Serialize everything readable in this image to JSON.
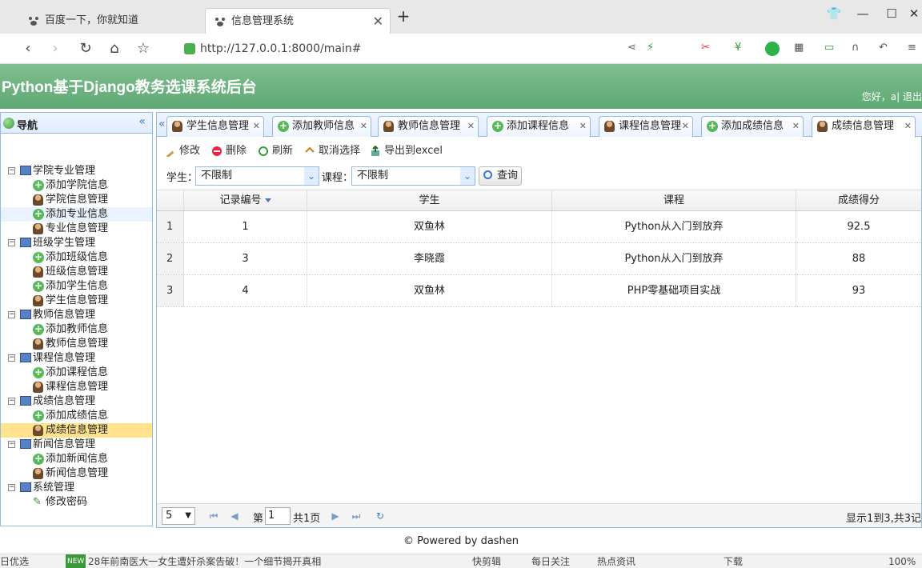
{
  "browser": {
    "tabs": [
      {
        "title": "百度一下，你就知道",
        "active": false
      },
      {
        "title": "信息管理系统",
        "active": true
      }
    ],
    "new_tab": "+",
    "url": "http://127.0.0.1:8000/main#"
  },
  "app": {
    "title": "Python基于Django教务选课系统后台",
    "welcome": "您好，a| 退出"
  },
  "nav": {
    "title": "导航",
    "collapse_icon": "«",
    "groups": [
      {
        "label": "学院专业管理",
        "items": [
          "添加学院信息",
          "学院信息管理",
          "添加专业信息",
          "专业信息管理"
        ]
      },
      {
        "label": "班级学生管理",
        "items": [
          "添加班级信息",
          "班级信息管理",
          "添加学生信息",
          "学生信息管理"
        ]
      },
      {
        "label": "教师信息管理",
        "items": [
          "添加教师信息",
          "教师信息管理"
        ]
      },
      {
        "label": "课程信息管理",
        "items": [
          "添加课程信息",
          "课程信息管理"
        ]
      },
      {
        "label": "成绩信息管理",
        "items": [
          "添加成绩信息",
          "成绩信息管理"
        ]
      },
      {
        "label": "新闻信息管理",
        "items": [
          "添加新闻信息",
          "新闻信息管理"
        ]
      },
      {
        "label": "系统管理",
        "items": [
          "修改密码"
        ]
      }
    ],
    "selected_item": "成绩信息管理"
  },
  "content_tabs": [
    {
      "label": "学生信息管理",
      "icon": "user-icon"
    },
    {
      "label": "添加教师信息",
      "icon": "add-icon"
    },
    {
      "label": "教师信息管理",
      "icon": "user-icon"
    },
    {
      "label": "添加课程信息",
      "icon": "add-icon"
    },
    {
      "label": "课程信息管理",
      "icon": "user-icon"
    },
    {
      "label": "添加成绩信息",
      "icon": "add-icon"
    },
    {
      "label": "成绩信息管理",
      "icon": "user-icon",
      "active": true
    }
  ],
  "grid_toolbar": {
    "edit": "修改",
    "delete": "删除",
    "refresh": "刷新",
    "unselect": "取消选择",
    "export": "导出到excel"
  },
  "filter": {
    "student_label": "学生：",
    "student_value": "不限制",
    "course_label": "课程：",
    "course_value": "不限制",
    "query": "查询"
  },
  "table": {
    "columns": [
      "记录编号",
      "学生",
      "课程",
      "成绩得分"
    ],
    "rows": [
      {
        "rownum": "1",
        "id": "1",
        "student": "双鱼林",
        "course": "Python从入门到放弃",
        "score": "92.5"
      },
      {
        "rownum": "2",
        "id": "3",
        "student": "李晓霞",
        "course": "Python从入门到放弃",
        "score": "88"
      },
      {
        "rownum": "3",
        "id": "4",
        "student": "双鱼林",
        "course": "PHP零基础项目实战",
        "score": "93"
      }
    ]
  },
  "pager": {
    "page_size": "5",
    "page_prefix": "第",
    "page_value": "1",
    "total_pages": "共1页",
    "summary": "显示1到3,共3记"
  },
  "footer": "© Powered by dashen",
  "statusbar": {
    "left": "日优选",
    "news": "28年前南医大一女生遭奸杀案告破！一个细节揭开真相",
    "items": [
      "快剪辑",
      "每日关注",
      "热点资讯",
      "下载",
      "100%"
    ]
  },
  "colors": {
    "header_green": "#6db07f",
    "panel_border": "#95b8e7",
    "selected_row": "#ffe48d"
  }
}
